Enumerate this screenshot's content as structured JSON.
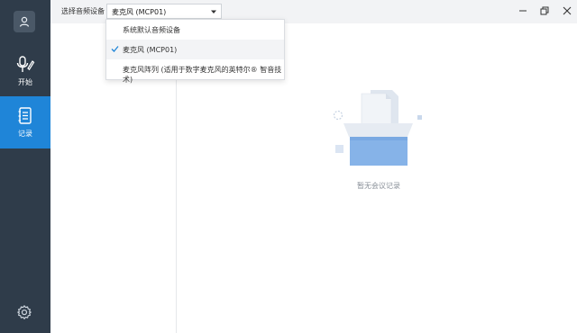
{
  "topbar": {
    "label": "选择音频设备",
    "selected_device": "麦克风 (MCP01)"
  },
  "device_menu": {
    "items": [
      {
        "label": "系统默认音频设备",
        "checked": false
      },
      {
        "label": "麦克风 (MCP01)",
        "checked": true
      },
      {
        "label": "麦克风阵列 (适用于数字麦克风的英特尔® 智音技术)",
        "checked": false
      }
    ]
  },
  "sidebar": {
    "items": [
      {
        "label": "开始",
        "icon": "mic-icon"
      },
      {
        "label": "记录",
        "icon": "notebook-icon",
        "active": true
      }
    ]
  },
  "empty_state": {
    "message": "暂无会议记录"
  },
  "colors": {
    "rail": "#2f3c4a",
    "active": "#1f85d8"
  }
}
